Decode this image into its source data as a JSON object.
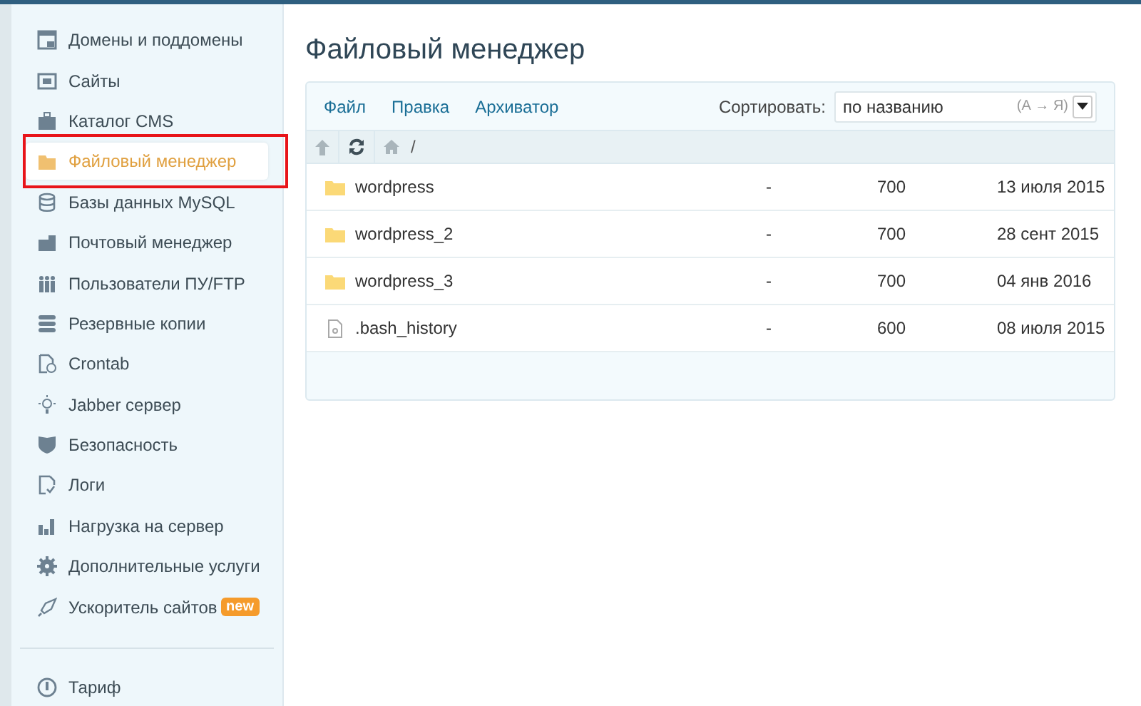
{
  "sidebar": {
    "items": [
      {
        "label": "Домены и поддомены",
        "selected": false,
        "highlighted": false
      },
      {
        "label": "Сайты",
        "selected": false,
        "highlighted": false
      },
      {
        "label": "Каталог CMS",
        "selected": false,
        "highlighted": false
      },
      {
        "label": "Файловый менеджер",
        "selected": true,
        "highlighted": true
      },
      {
        "label": "Базы данных MySQL",
        "selected": false,
        "highlighted": false
      },
      {
        "label": "Почтовый менеджер",
        "selected": false,
        "highlighted": false
      },
      {
        "label": "Пользователи ПУ/FTP",
        "selected": false,
        "highlighted": false
      },
      {
        "label": "Резервные копии",
        "selected": false,
        "highlighted": false
      },
      {
        "label": "Crontab",
        "selected": false,
        "highlighted": false
      },
      {
        "label": "Jabber сервер",
        "selected": false,
        "highlighted": false
      },
      {
        "label": "Безопасность",
        "selected": false,
        "highlighted": false
      },
      {
        "label": "Логи",
        "selected": false,
        "highlighted": false
      },
      {
        "label": "Нагрузка на сервер",
        "selected": false,
        "highlighted": false
      },
      {
        "label": "Дополнительные услуги",
        "selected": false,
        "highlighted": false
      },
      {
        "label": "Ускоритель сайтов",
        "selected": false,
        "highlighted": false,
        "badge": "new"
      }
    ],
    "footer_item": {
      "label": "Тариф"
    }
  },
  "page_title": "Файловый менеджер",
  "menu": [
    "Файл",
    "Правка",
    "Архиватор"
  ],
  "sort": {
    "label": "Сортировать:",
    "value": "по названию",
    "order": "(А → Я)"
  },
  "path": "/",
  "files": [
    {
      "kind": "folder",
      "name": "wordpress",
      "size": "-",
      "perms": "700",
      "date": "13 июля 2015"
    },
    {
      "kind": "folder",
      "name": "wordpress_2",
      "size": "-",
      "perms": "700",
      "date": "28 сент 2015"
    },
    {
      "kind": "folder",
      "name": "wordpress_3",
      "size": "-",
      "perms": "700",
      "date": "04 янв 2016"
    },
    {
      "kind": "file",
      "name": ".bash_history",
      "size": "-",
      "perms": "600",
      "date": "08 июля 2015"
    }
  ]
}
